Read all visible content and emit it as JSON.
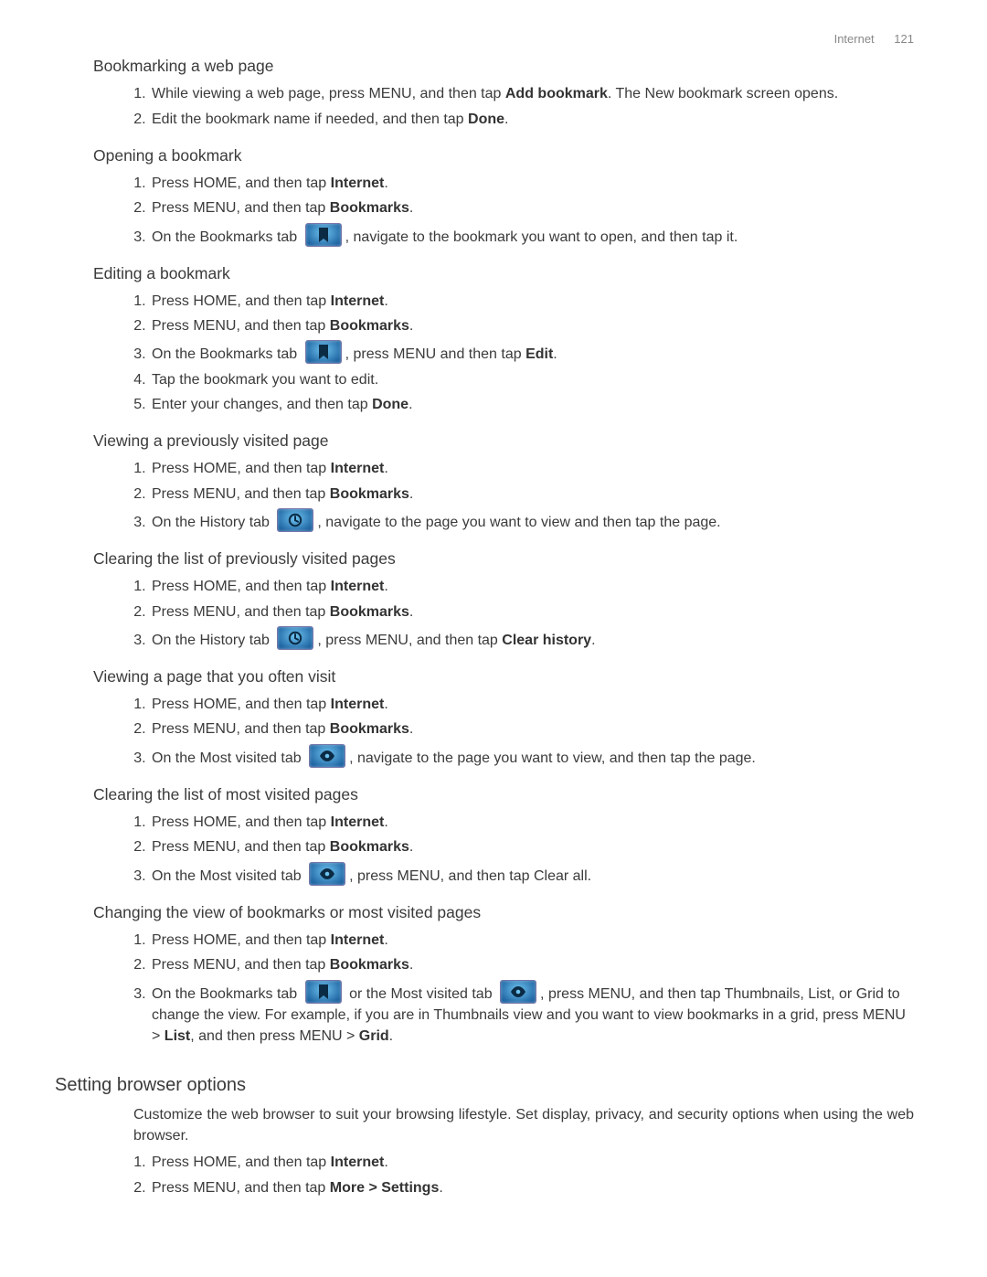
{
  "header": {
    "section": "Internet",
    "page": "121"
  },
  "sections": [
    {
      "id": "s1",
      "heading": "Bookmarking a web page",
      "list": [
        [
          {
            "t": "While viewing a web page, press MENU, and then tap "
          },
          {
            "t": "Add bookmark",
            "b": true
          },
          {
            "t": ". The New bookmark screen opens."
          }
        ],
        [
          {
            "t": "Edit the bookmark name if needed, and then tap "
          },
          {
            "t": "Done",
            "b": true
          },
          {
            "t": "."
          }
        ]
      ]
    },
    {
      "id": "s2",
      "heading": "Opening a bookmark",
      "list": [
        [
          {
            "t": "Press HOME, and then tap "
          },
          {
            "t": "Internet",
            "b": true
          },
          {
            "t": "."
          }
        ],
        [
          {
            "t": "Press MENU, and then tap "
          },
          {
            "t": "Bookmarks",
            "b": true
          },
          {
            "t": "."
          }
        ],
        [
          {
            "t": "On the Bookmarks tab "
          },
          {
            "icon": "bookmark"
          },
          {
            "t": ", navigate to the bookmark you want to open, and then tap it."
          }
        ]
      ]
    },
    {
      "id": "s3",
      "heading": "Editing a bookmark",
      "list": [
        [
          {
            "t": "Press HOME, and then tap "
          },
          {
            "t": "Internet",
            "b": true
          },
          {
            "t": "."
          }
        ],
        [
          {
            "t": "Press MENU, and then tap "
          },
          {
            "t": "Bookmarks",
            "b": true
          },
          {
            "t": "."
          }
        ],
        [
          {
            "t": "On the Bookmarks tab "
          },
          {
            "icon": "bookmark"
          },
          {
            "t": ", press MENU and then tap "
          },
          {
            "t": "Edit",
            "b": true
          },
          {
            "t": "."
          }
        ],
        [
          {
            "t": "Tap the bookmark you want to edit."
          }
        ],
        [
          {
            "t": "Enter your changes, and then tap "
          },
          {
            "t": "Done",
            "b": true
          },
          {
            "t": "."
          }
        ]
      ]
    },
    {
      "id": "s4",
      "heading": "Viewing a previously visited page",
      "list": [
        [
          {
            "t": "Press HOME, and then tap "
          },
          {
            "t": "Internet",
            "b": true
          },
          {
            "t": "."
          }
        ],
        [
          {
            "t": "Press MENU, and then tap "
          },
          {
            "t": "Bookmarks",
            "b": true
          },
          {
            "t": "."
          }
        ],
        [
          {
            "t": "On the History tab "
          },
          {
            "icon": "history"
          },
          {
            "t": ", navigate to the page you want to view and then tap the page."
          }
        ]
      ]
    },
    {
      "id": "s5",
      "heading": "Clearing the list of previously visited pages",
      "list": [
        [
          {
            "t": "Press HOME, and then tap "
          },
          {
            "t": "Internet",
            "b": true
          },
          {
            "t": "."
          }
        ],
        [
          {
            "t": "Press MENU, and then tap "
          },
          {
            "t": "Bookmarks",
            "b": true
          },
          {
            "t": "."
          }
        ],
        [
          {
            "t": "On the History tab "
          },
          {
            "icon": "history"
          },
          {
            "t": ", press MENU, and then tap "
          },
          {
            "t": "Clear history",
            "b": true
          },
          {
            "t": "."
          }
        ]
      ]
    },
    {
      "id": "s6",
      "heading": "Viewing a page that you often visit",
      "list": [
        [
          {
            "t": "Press HOME, and then tap "
          },
          {
            "t": "Internet",
            "b": true
          },
          {
            "t": "."
          }
        ],
        [
          {
            "t": "Press MENU, and then tap "
          },
          {
            "t": "Bookmarks",
            "b": true
          },
          {
            "t": "."
          }
        ],
        [
          {
            "t": "On the Most visited tab "
          },
          {
            "icon": "eye"
          },
          {
            "t": ", navigate to the page you want to view, and then tap the page."
          }
        ]
      ]
    },
    {
      "id": "s7",
      "heading": "Clearing the list of most visited pages",
      "list": [
        [
          {
            "t": "Press HOME, and then tap "
          },
          {
            "t": "Internet",
            "b": true
          },
          {
            "t": "."
          }
        ],
        [
          {
            "t": "Press MENU, and then tap "
          },
          {
            "t": "Bookmarks",
            "b": true
          },
          {
            "t": "."
          }
        ],
        [
          {
            "t": "On the Most visited tab "
          },
          {
            "icon": "eye"
          },
          {
            "t": ", press MENU, and then tap Clear all."
          }
        ]
      ]
    },
    {
      "id": "s8",
      "heading": "Changing the view of bookmarks or most visited pages",
      "list": [
        [
          {
            "t": "Press HOME, and then tap "
          },
          {
            "t": "Internet",
            "b": true
          },
          {
            "t": "."
          }
        ],
        [
          {
            "t": "Press MENU, and then tap "
          },
          {
            "t": "Bookmarks",
            "b": true
          },
          {
            "t": "."
          }
        ],
        [
          {
            "t": "On the Bookmarks tab "
          },
          {
            "icon": "bookmark"
          },
          {
            "t": " or the Most visited tab "
          },
          {
            "icon": "eye"
          },
          {
            "t": ", press MENU, and then tap Thumbnails, List, or Grid to change the view. For example, if you are in Thumbnails view and you want to view bookmarks in a grid, press MENU > "
          },
          {
            "t": "List",
            "b": true
          },
          {
            "t": ", and then press MENU > "
          },
          {
            "t": "Grid",
            "b": true
          },
          {
            "t": "."
          }
        ]
      ]
    }
  ],
  "major": {
    "heading": "Setting browser options",
    "para": "Customize the web browser to suit your browsing lifestyle. Set display, privacy, and security options when using the web browser.",
    "list": [
      [
        {
          "t": "Press HOME, and then tap "
        },
        {
          "t": "Internet",
          "b": true
        },
        {
          "t": "."
        }
      ],
      [
        {
          "t": "Press MENU, and then tap "
        },
        {
          "t": "More > Settings",
          "b": true
        },
        {
          "t": "."
        }
      ]
    ]
  }
}
